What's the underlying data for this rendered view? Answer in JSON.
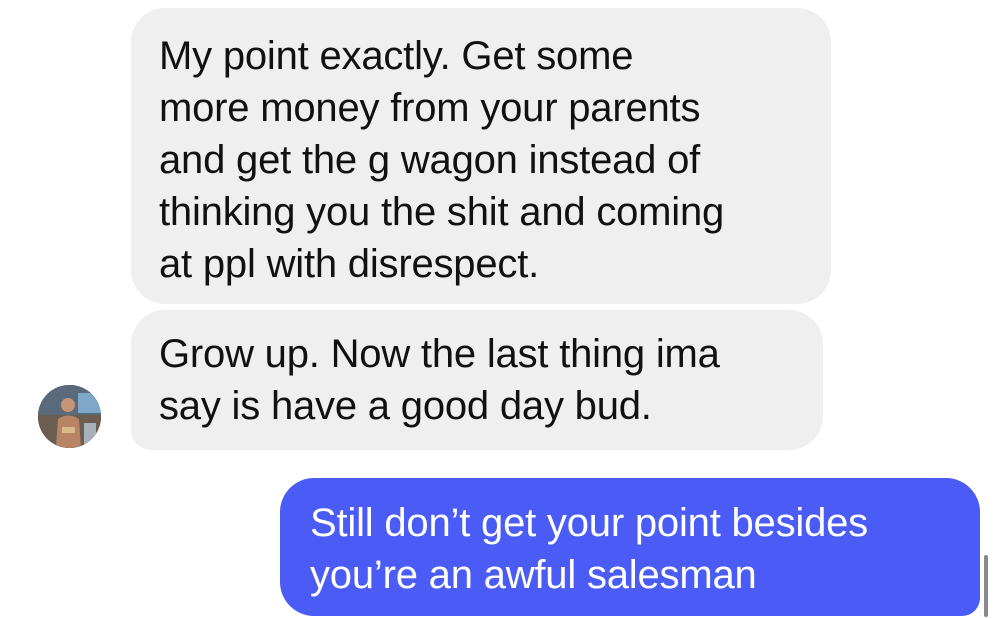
{
  "messages": [
    {
      "direction": "incoming",
      "text": "My point exactly. Get some\nmore money from your parents\nand get the g wagon instead of\nthinking you the shit and coming\nat ppl with disrespect."
    },
    {
      "direction": "incoming",
      "text": "Grow up. Now the last thing ima\nsay is have a good day bud."
    },
    {
      "direction": "outgoing",
      "text": "Still don’t get your point besides\nyou’re an awful salesman"
    }
  ],
  "colors": {
    "incoming_bubble": "#efeff0",
    "outgoing_bubble": "#4a5cf5",
    "incoming_text": "#111111",
    "outgoing_text": "#ffffff"
  },
  "icons": {
    "avatar": "contact-avatar-photo"
  }
}
